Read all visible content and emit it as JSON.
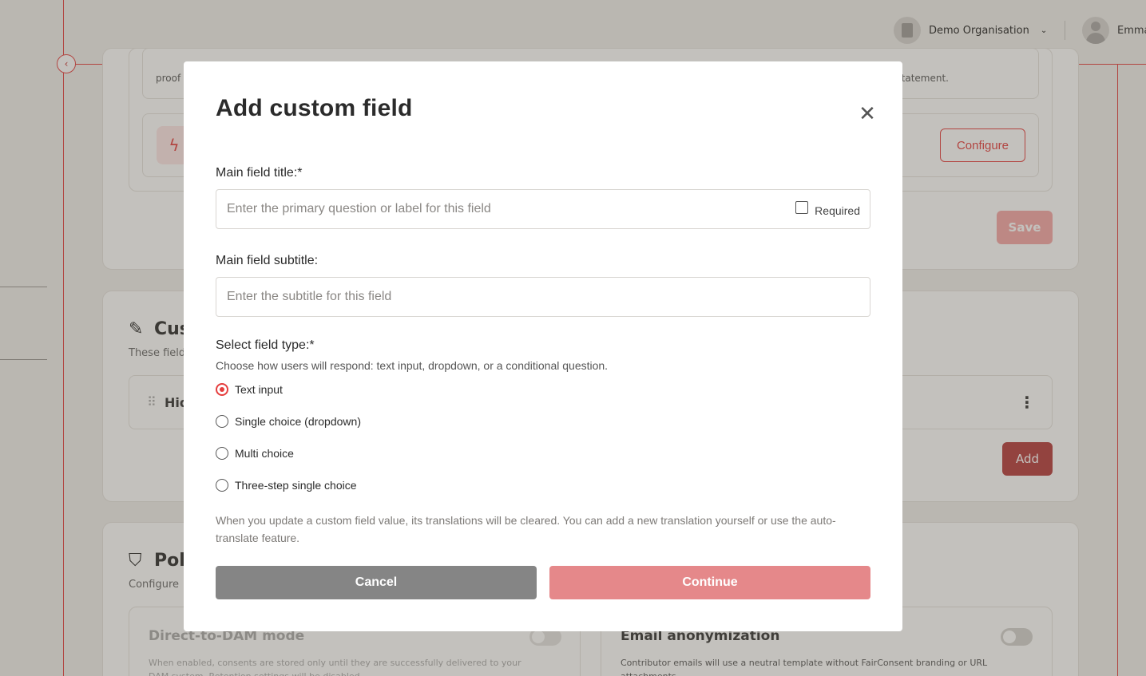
{
  "header": {
    "org_name": "Demo Organisation",
    "user_name": "Emma"
  },
  "background": {
    "card1": {
      "line1_left": "proof c",
      "line1_right": "tatement.",
      "configure_label": "Configure",
      "save_label": "Save"
    },
    "custom_fields": {
      "title": "Cus",
      "subtitle": "These field",
      "row_label": "Hid",
      "add_label": "Add"
    },
    "policies": {
      "title": "Poli",
      "subtitle": "Configure",
      "dam_title": "Direct-to-DAM mode",
      "dam_desc": "When enabled, consents are stored only until they are successfully delivered to your DAM system. Retention settings will be disabled.",
      "email_title": "Email anonymization",
      "email_desc": "Contributor emails will use a neutral template without FairConsent branding or URL attachments."
    }
  },
  "modal": {
    "title": "Add custom field",
    "main_title_label": "Main field title:*",
    "main_title_placeholder": "Enter the primary question or label for this field",
    "required_label": "Required",
    "subtitle_label": "Main field subtitle:",
    "subtitle_placeholder": "Enter the subtitle for this field",
    "field_type_label": "Select field type:*",
    "field_type_desc": "Choose how users will respond: text input, dropdown, or a conditional question.",
    "options": [
      {
        "label": "Text input",
        "selected": true
      },
      {
        "label": "Single choice (dropdown)",
        "selected": false
      },
      {
        "label": "Multi choice",
        "selected": false
      },
      {
        "label": "Three-step single choice",
        "selected": false
      }
    ],
    "note": "When you update a custom field value, its translations will be cleared. You can add a new translation yourself or use the auto-translate feature.",
    "cancel_label": "Cancel",
    "continue_label": "Continue"
  },
  "colors": {
    "accent": "#e53e3e",
    "continue_disabled": "#e5888a",
    "cancel": "#858585"
  }
}
